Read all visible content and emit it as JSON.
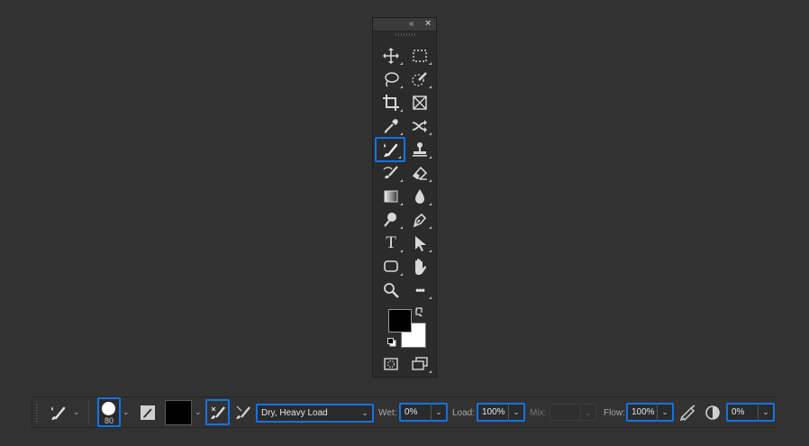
{
  "tools_panel": {
    "collapse_icon": "«",
    "close_icon": "×",
    "tools": [
      {
        "name": "move-tool",
        "icon": "move-icon"
      },
      {
        "name": "rectangular-marquee-tool",
        "icon": "marquee-rect-icon"
      },
      {
        "name": "lasso-tool",
        "icon": "lasso-icon"
      },
      {
        "name": "quick-selection-tool",
        "icon": "quick-selection-icon"
      },
      {
        "name": "crop-tool",
        "icon": "crop-icon"
      },
      {
        "name": "frame-tool",
        "icon": "frame-icon"
      },
      {
        "name": "eyedropper-tool",
        "icon": "eyedropper-icon"
      },
      {
        "name": "patch-tool",
        "icon": "patch-icon"
      },
      {
        "name": "mixer-brush-tool",
        "icon": "mixer-brush-icon",
        "active": true
      },
      {
        "name": "clone-stamp-tool",
        "icon": "stamp-icon"
      },
      {
        "name": "history-brush-tool",
        "icon": "history-brush-icon"
      },
      {
        "name": "eraser-tool",
        "icon": "eraser-icon"
      },
      {
        "name": "gradient-tool",
        "icon": "gradient-icon"
      },
      {
        "name": "blur-tool",
        "icon": "drop-icon"
      },
      {
        "name": "dodge-tool",
        "icon": "dodge-icon"
      },
      {
        "name": "pen-tool",
        "icon": "pen-icon"
      },
      {
        "name": "type-tool",
        "icon": "type-icon",
        "glyph": "T"
      },
      {
        "name": "path-selection-tool",
        "icon": "arrow-icon"
      },
      {
        "name": "rectangle-tool",
        "icon": "rounded-rect-icon"
      },
      {
        "name": "hand-tool",
        "icon": "hand-icon"
      },
      {
        "name": "zoom-tool",
        "icon": "zoom-icon"
      },
      {
        "name": "edit-toolbar",
        "icon": "more-icon",
        "glyph": "•••"
      },
      {
        "name": "quick-mask",
        "icon": "quick-mask-icon"
      },
      {
        "name": "screen-mode",
        "icon": "screen-mode-icon"
      }
    ],
    "foreground_color": "#000000",
    "background_color": "#ffffff"
  },
  "options_bar": {
    "brush_size": "80",
    "mix_preset": "Dry, Heavy Load",
    "wet_label": "Wet:",
    "wet_value": "0%",
    "load_label": "Load:",
    "load_value": "100%",
    "mix_label": "Mix:",
    "mix_value": "",
    "flow_label": "Flow:",
    "flow_value": "100%",
    "smoothing_value": "0%",
    "chevron": "⌄",
    "dropdown_arrow": "⌄"
  },
  "colors": {
    "accent": "#1473e6",
    "background": "#323232",
    "panel": "#2b2b2b"
  }
}
